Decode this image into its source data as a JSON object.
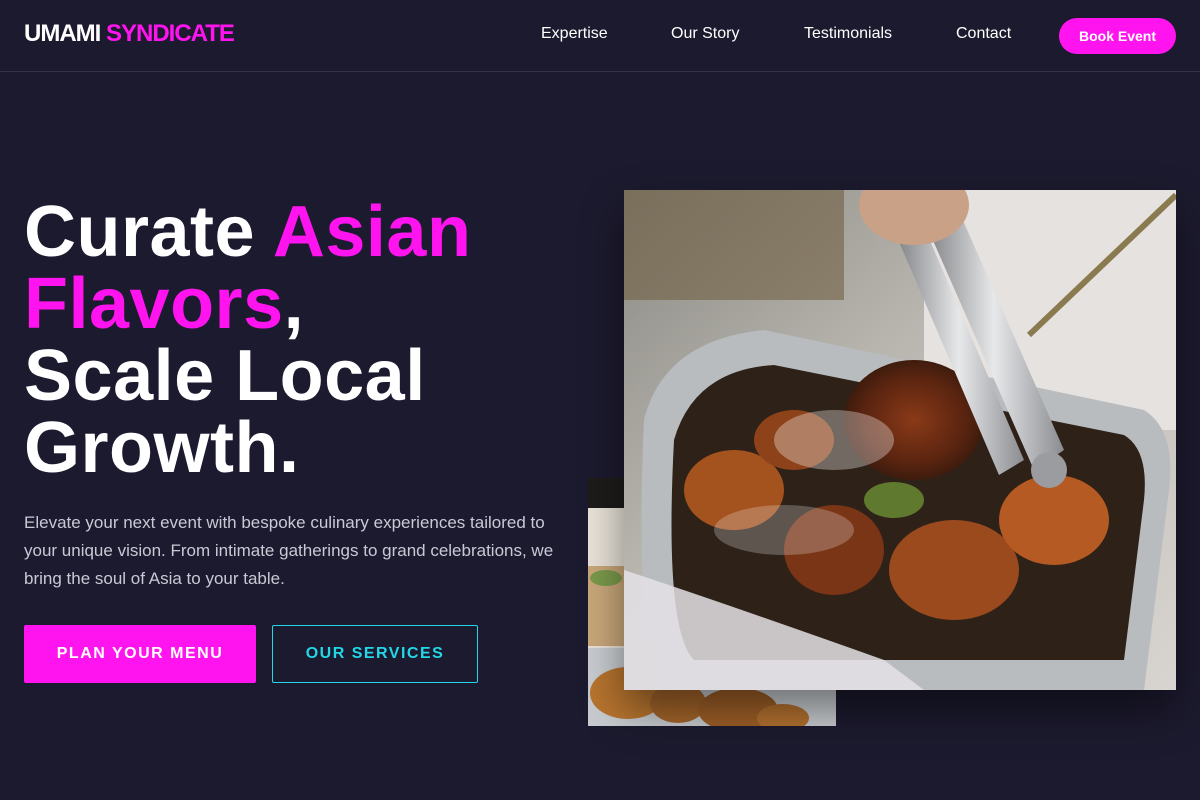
{
  "brand": {
    "name_part1": "UMAMI",
    "name_part2": "SYNDICATE",
    "accent_color": "#ff14f0"
  },
  "nav": {
    "links": [
      {
        "label": "Expertise"
      },
      {
        "label": "Our Story"
      },
      {
        "label": "Testimonials"
      },
      {
        "label": "Contact"
      }
    ],
    "cta_label": "Book Event"
  },
  "hero": {
    "title_word1": "Curate ",
    "title_accent1": "Asian",
    "title_accent2": "Flavors",
    "title_comma": ",",
    "title_line3": "Scale Local",
    "title_line4": "Growth.",
    "subtitle": "Elevate your next event with bespoke culinary experiences tailored to your unique vision. From intimate gatherings to grand celebrations, we bring the soul of Asia to your table.",
    "primary_cta": "PLAN YOUR MENU",
    "secondary_cta": "OUR SERVICES",
    "secondary_color": "#22d8e8"
  },
  "images": {
    "main_icon": "food-photo-tongs-grilled-meat",
    "secondary_icon": "food-photo-catering-spread"
  },
  "colors": {
    "background": "#1c1a2e",
    "accent": "#ff14f0",
    "cyan": "#22d8e8"
  }
}
